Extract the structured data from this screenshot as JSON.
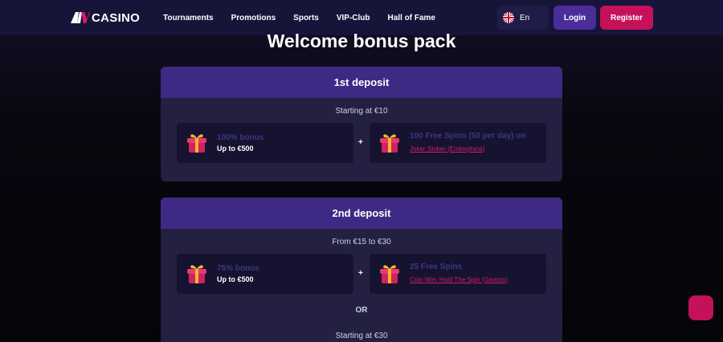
{
  "header": {
    "logo_text": "CASINO",
    "nav": [
      "Tournaments",
      "Promotions",
      "Sports",
      "VIP-Club",
      "Hall of Fame"
    ],
    "language": "En",
    "login_label": "Login",
    "register_label": "Register"
  },
  "page": {
    "title": "Welcome bonus pack"
  },
  "deposits": [
    {
      "title": "1st deposit",
      "range": "Starting at €10",
      "left": {
        "main": "100% bonus",
        "sub": "Up to €500"
      },
      "plus": "+",
      "right": {
        "main": "100 Free Spins (50 per day) on",
        "link": "Joker Stoker (Endorphina)"
      }
    },
    {
      "title": "2nd deposit",
      "range": "From €15 to €30",
      "left": {
        "main": "75% bonus",
        "sub": "Up to €500"
      },
      "plus": "+",
      "right": {
        "main": "25 Free Spins",
        "link": "Coin Win: Hold The Spin (Gamzix)"
      },
      "or_label": "OR",
      "range2": "Starting at €30"
    }
  ],
  "colors": {
    "header_bg": "#17143a",
    "card_head": "#3e2a84",
    "card_bg": "#232042",
    "accent_pink": "#c4115a",
    "accent_purple": "#4b2d9a"
  },
  "icons": [
    "logo-icon",
    "uk-flag-icon",
    "gift-icon",
    "chat-icon"
  ]
}
